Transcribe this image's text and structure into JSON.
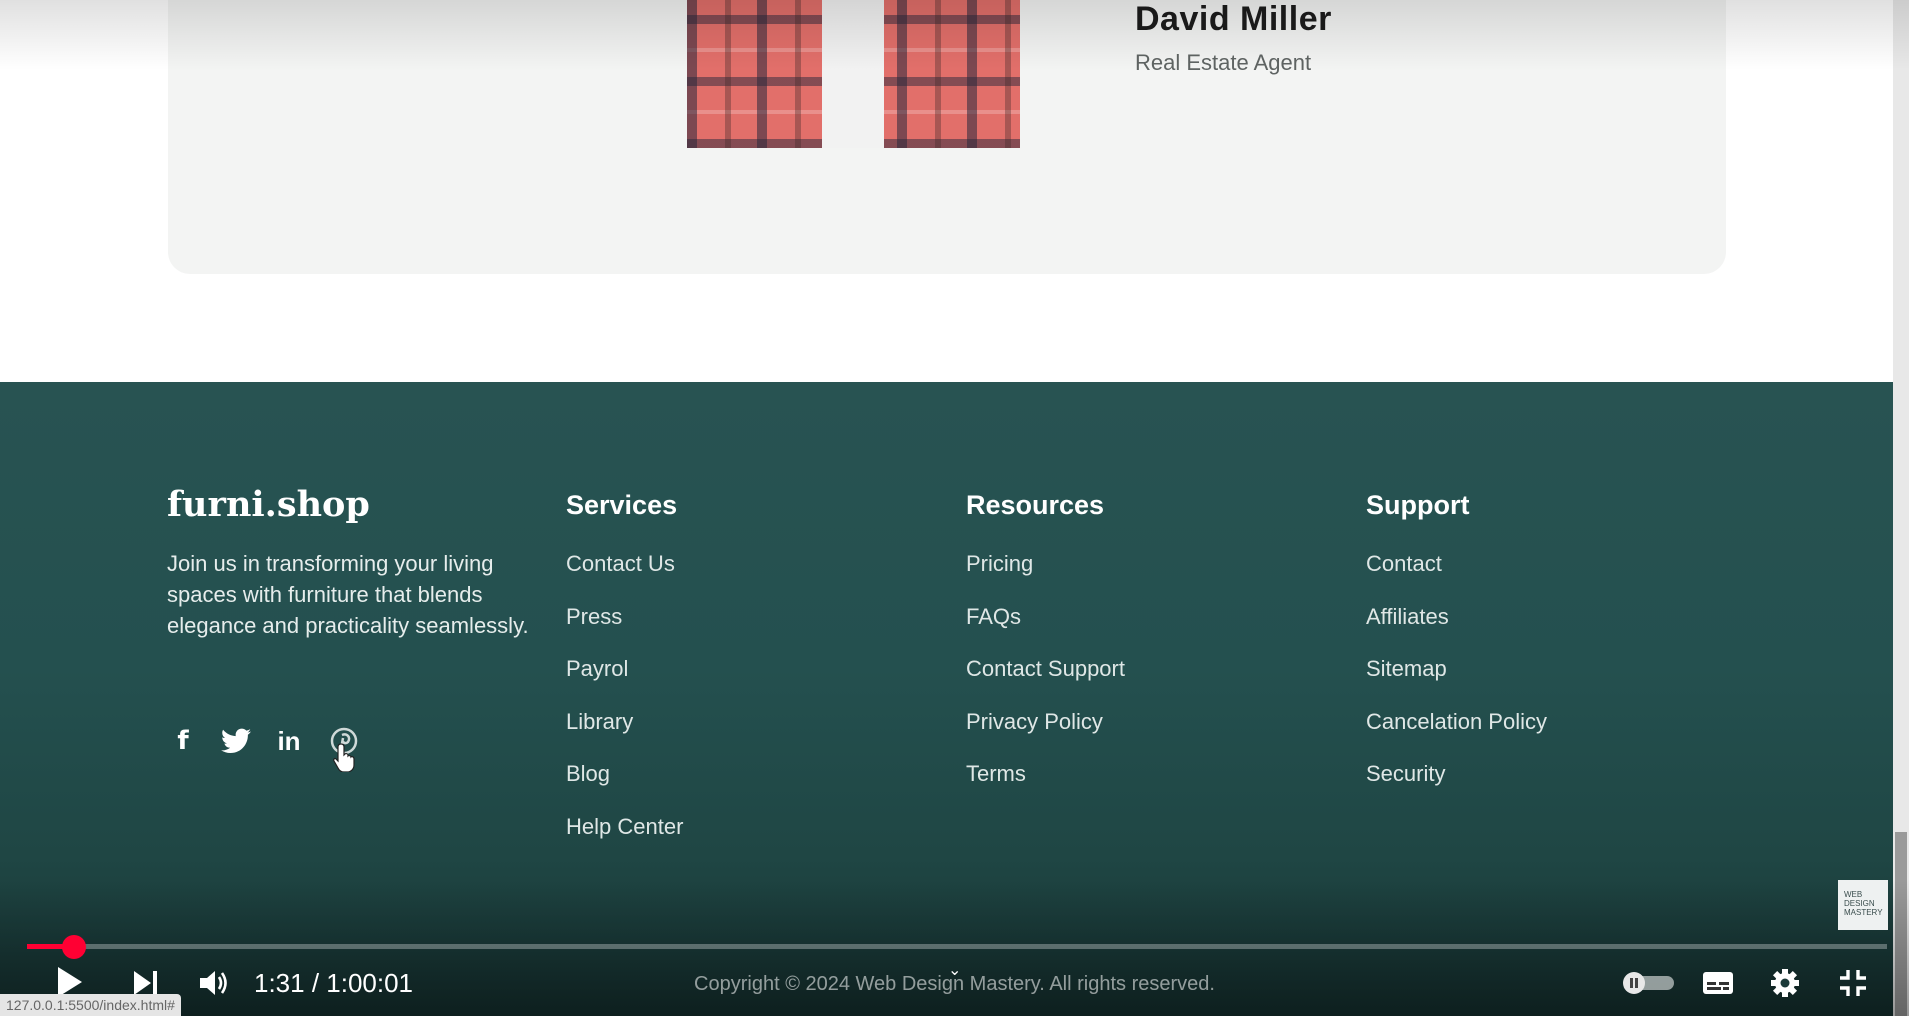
{
  "testimonial": {
    "name": "David Miller",
    "role": "Real Estate Agent"
  },
  "footer": {
    "brand": "furni.shop",
    "about": "Join us in transforming your living spaces with furniture that blends elegance and practicality seamlessly.",
    "social": [
      "facebook-icon",
      "twitter-icon",
      "linkedin-icon",
      "pinterest-icon"
    ],
    "social_glyphs": {
      "facebook": "f",
      "linkedin": "in"
    },
    "columns": [
      {
        "title": "Services",
        "links": [
          "Contact Us",
          "Press",
          "Payrol",
          "Library",
          "Blog",
          "Help Center"
        ]
      },
      {
        "title": "Resources",
        "links": [
          "Pricing",
          "FAQs",
          "Contact Support",
          "Privacy Policy",
          "Terms"
        ]
      },
      {
        "title": "Support",
        "links": [
          "Contact",
          "Affiliates",
          "Sitemap",
          "Cancelation Policy",
          "Security"
        ]
      }
    ],
    "copyright": "Copyright © 2024 Web Design Mastery. All rights reserved."
  },
  "player": {
    "current_time": "1:31",
    "duration": "1:00:01",
    "time_display": "1:31 / 1:00:01",
    "progress_fraction": 0.025,
    "accent_color": "#ff0033",
    "watermark": [
      "WEB",
      "DESIGN",
      "MASTERY"
    ]
  },
  "status_url": "127.0.0.1:5500/index.html#",
  "colors": {
    "footer_bg": "#285352",
    "card_bg": "#f3f4f3"
  }
}
